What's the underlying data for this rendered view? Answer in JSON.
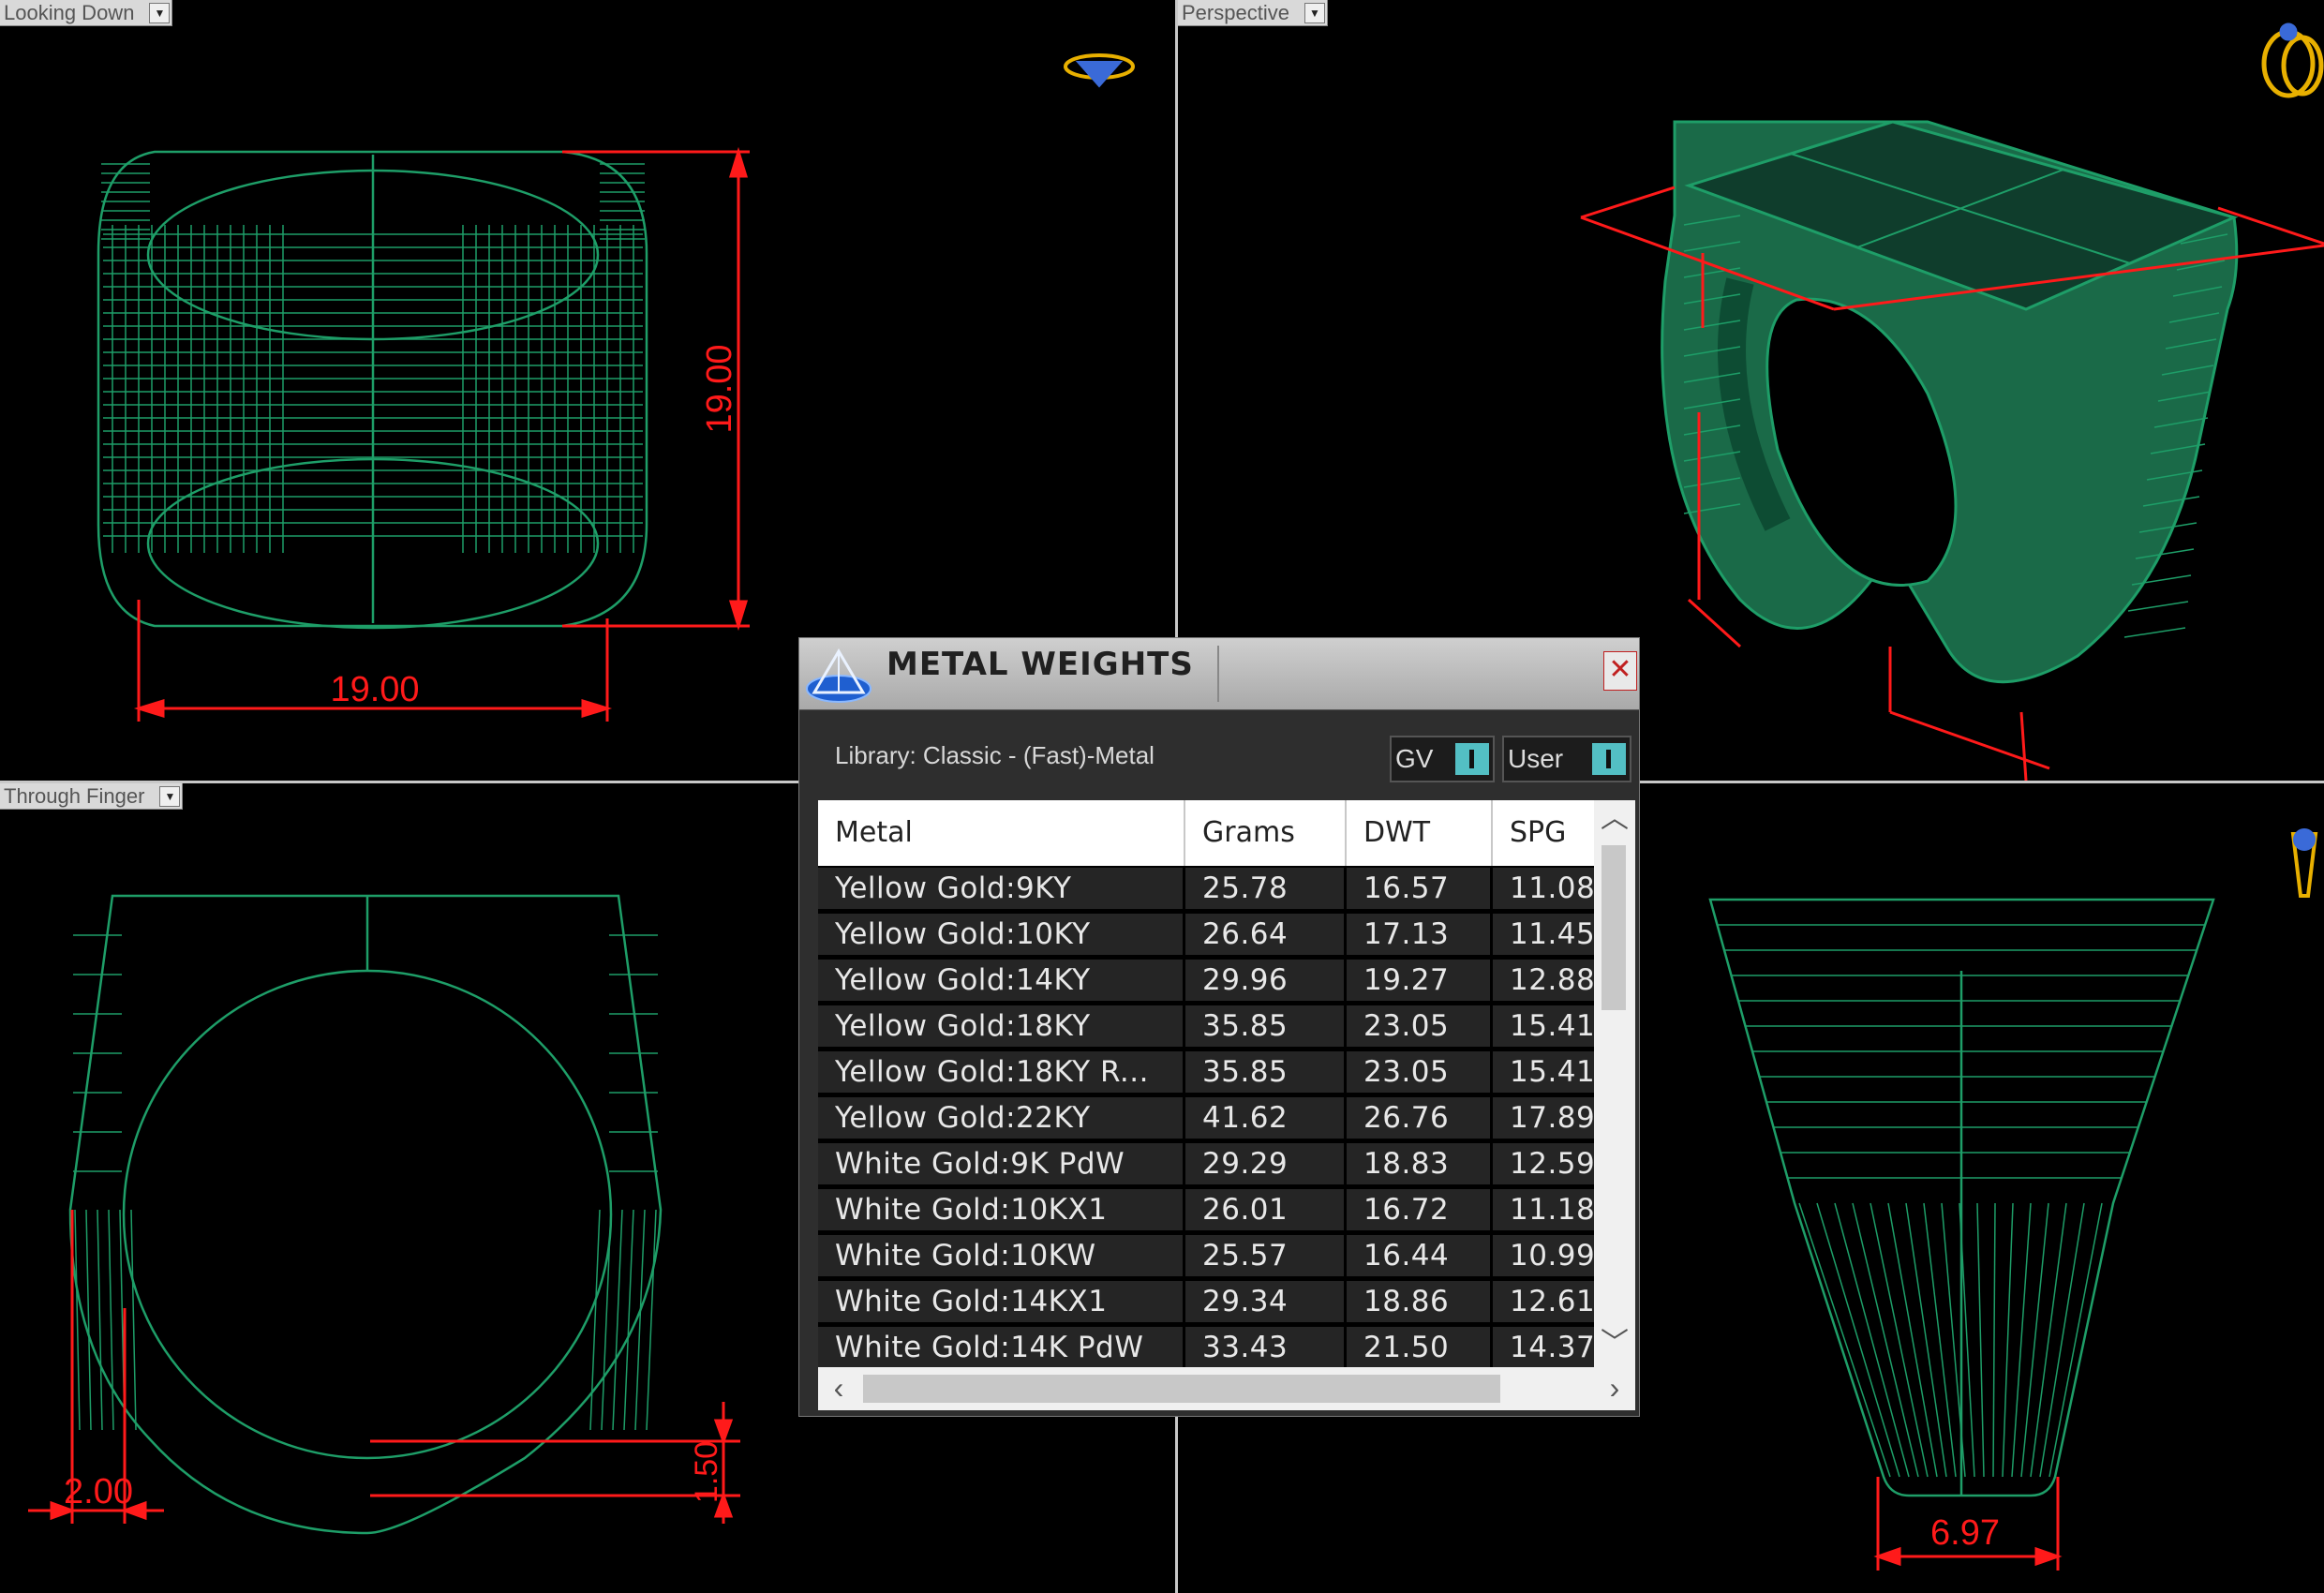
{
  "viewports": {
    "top_left": {
      "label": "Looking Down"
    },
    "top_right": {
      "label": "Perspective"
    },
    "bottom_left": {
      "label": "Through Finger"
    },
    "bottom_right": {
      "label": ""
    }
  },
  "dimensions": {
    "looking_down_width": "19.00",
    "looking_down_height": "19.00",
    "through_finger_thickness": "2.00",
    "through_finger_bottom": "1.50",
    "front_bottom_width": "6.97"
  },
  "colors": {
    "wire": "#1e9e68",
    "solid": "#1a6a48",
    "dimension": "#ff1a1a",
    "icon": "#e8b000"
  },
  "dialog": {
    "title": "METAL WEIGHTS",
    "close_label": "✕",
    "library": "Library: Classic - (Fast)-Metal",
    "toggle_gv": "GV",
    "toggle_user": "User",
    "columns": [
      "Metal",
      "Grams",
      "DWT",
      "SPG"
    ],
    "rows": [
      [
        "Yellow Gold:9KY",
        "25.78",
        "16.57",
        "11.08"
      ],
      [
        "Yellow Gold:10KY",
        "26.64",
        "17.13",
        "11.45"
      ],
      [
        "Yellow Gold:14KY",
        "29.96",
        "19.27",
        "12.88"
      ],
      [
        "Yellow Gold:18KY",
        "35.85",
        "23.05",
        "15.41"
      ],
      [
        "Yellow Gold:18KY R...",
        "35.85",
        "23.05",
        "15.41"
      ],
      [
        "Yellow Gold:22KY",
        "41.62",
        "26.76",
        "17.89"
      ],
      [
        "White Gold:9K PdW",
        "29.29",
        "18.83",
        "12.59"
      ],
      [
        "White Gold:10KX1",
        "26.01",
        "16.72",
        "11.18"
      ],
      [
        "White Gold:10KW",
        "25.57",
        "16.44",
        "10.99"
      ],
      [
        "White Gold:14KX1",
        "29.34",
        "18.86",
        "12.61"
      ],
      [
        "White Gold:14K PdW",
        "33.43",
        "21.50",
        "14.37"
      ]
    ]
  }
}
